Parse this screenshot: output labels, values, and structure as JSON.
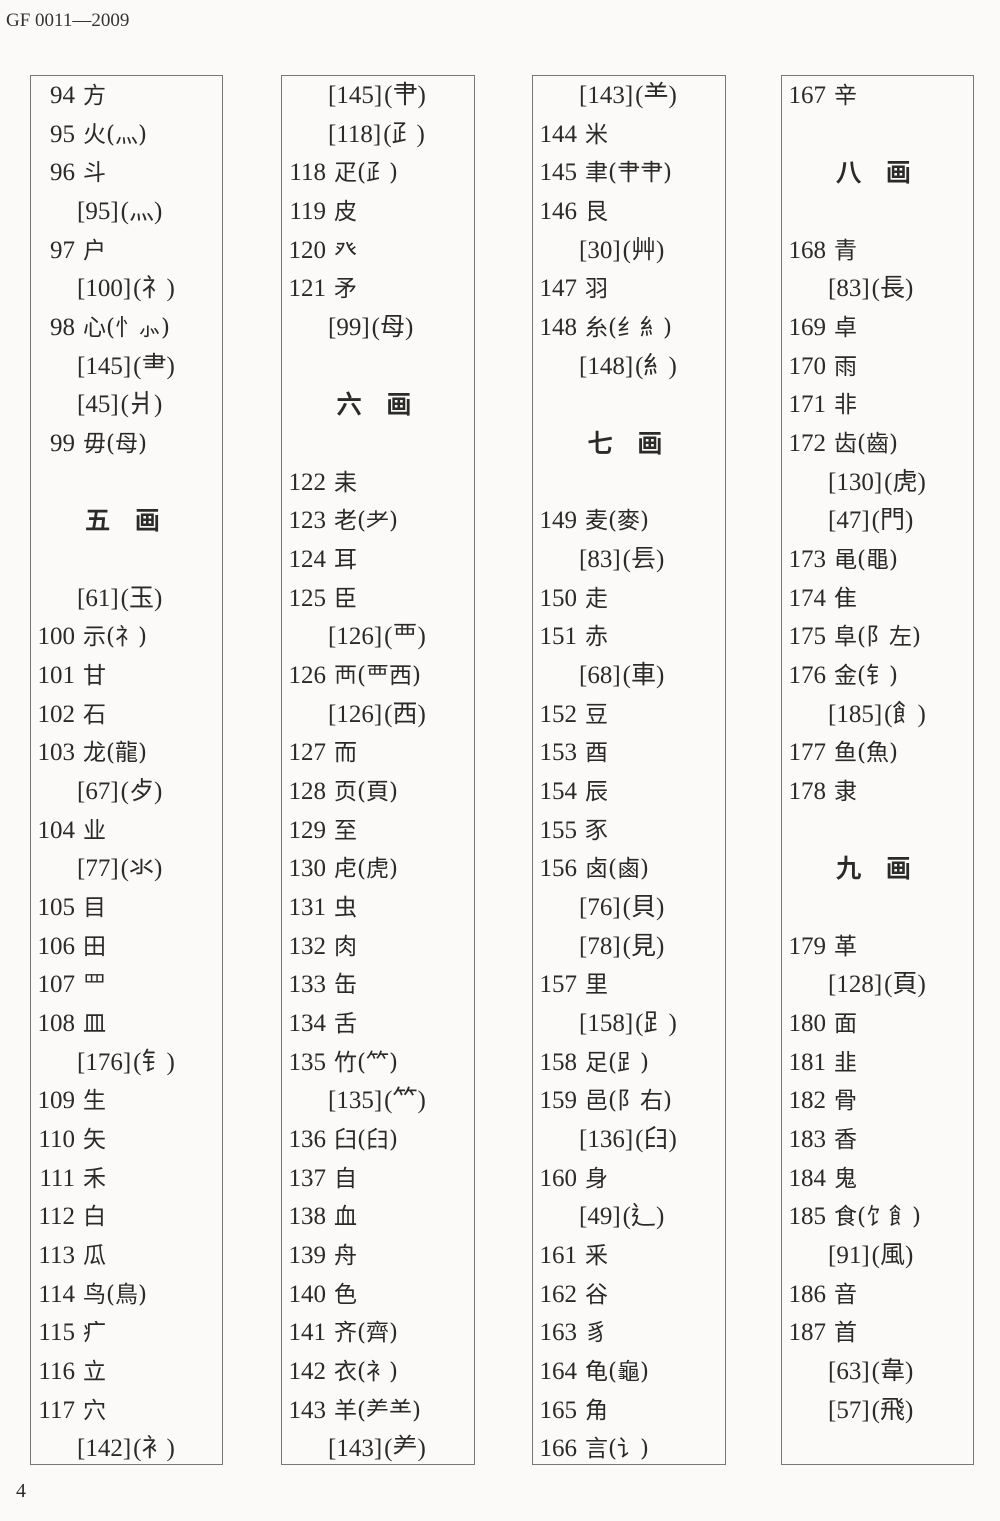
{
  "header": {
    "doc_id": "GF 0011—2009"
  },
  "footer": {
    "page_number": "4"
  },
  "columns": [
    [
      {
        "n": "94",
        "c": "方"
      },
      {
        "n": "95",
        "c": "火(灬)"
      },
      {
        "n": "96",
        "c": "斗"
      },
      {
        "ref": "[95]",
        "c": "(灬)"
      },
      {
        "n": "97",
        "c": "户"
      },
      {
        "ref": "[100]",
        "c": "(礻)"
      },
      {
        "n": "98",
        "c": "心(忄⺗)"
      },
      {
        "ref": "[145]",
        "c": "(⺻)"
      },
      {
        "ref": "[45]",
        "c": "(爿)"
      },
      {
        "n": "99",
        "c": "毋(母)"
      },
      null,
      {
        "h": "五 画"
      },
      null,
      {
        "ref": "[61]",
        "c": "(玉)"
      },
      {
        "n": "100",
        "c": "示(礻)"
      },
      {
        "n": "101",
        "c": "甘"
      },
      {
        "n": "102",
        "c": "石"
      },
      {
        "n": "103",
        "c": "龙(龍)"
      },
      {
        "ref": "[67]",
        "c": "(歺)"
      },
      {
        "n": "104",
        "c": "业"
      },
      {
        "ref": "[77]",
        "c": "(氺)"
      },
      {
        "n": "105",
        "c": "目"
      },
      {
        "n": "106",
        "c": "田"
      },
      {
        "n": "107",
        "c": "罒"
      },
      {
        "n": "108",
        "c": "皿"
      },
      {
        "ref": "[176]",
        "c": "(钅)"
      },
      {
        "n": "109",
        "c": "生"
      },
      {
        "n": "110",
        "c": "矢"
      },
      {
        "n": "111",
        "c": "禾"
      },
      {
        "n": "112",
        "c": "白"
      },
      {
        "n": "113",
        "c": "瓜"
      },
      {
        "n": "114",
        "c": "鸟(鳥)"
      },
      {
        "n": "115",
        "c": "疒"
      },
      {
        "n": "116",
        "c": "立"
      },
      {
        "n": "117",
        "c": "穴"
      },
      {
        "ref": "[142]",
        "c": "(衤)"
      }
    ],
    [
      {
        "ref": "[145]",
        "c": "(⺺)"
      },
      {
        "ref": "[118]",
        "c": "(⺪)"
      },
      {
        "n": "118",
        "c": "疋(⺪)"
      },
      {
        "n": "119",
        "c": "皮"
      },
      {
        "n": "120",
        "c": "癶"
      },
      {
        "n": "121",
        "c": "矛"
      },
      {
        "ref": "[99]",
        "c": "(母)"
      },
      null,
      {
        "h": "六 画"
      },
      null,
      {
        "n": "122",
        "c": "耒"
      },
      {
        "n": "123",
        "c": "老(耂)"
      },
      {
        "n": "124",
        "c": "耳"
      },
      {
        "n": "125",
        "c": "臣"
      },
      {
        "ref": "[126]",
        "c": "(覀)"
      },
      {
        "n": "126",
        "c": "襾(覀西)"
      },
      {
        "ref": "[126]",
        "c": "(西)"
      },
      {
        "n": "127",
        "c": "而"
      },
      {
        "n": "128",
        "c": "页(頁)"
      },
      {
        "n": "129",
        "c": "至"
      },
      {
        "n": "130",
        "c": "虍(虎)"
      },
      {
        "n": "131",
        "c": "虫"
      },
      {
        "n": "132",
        "c": "肉"
      },
      {
        "n": "133",
        "c": "缶"
      },
      {
        "n": "134",
        "c": "舌"
      },
      {
        "n": "135",
        "c": "竹(⺮)"
      },
      {
        "ref": "[135]",
        "c": "(⺮)"
      },
      {
        "n": "136",
        "c": "臼(𦥑)"
      },
      {
        "n": "137",
        "c": "自"
      },
      {
        "n": "138",
        "c": "血"
      },
      {
        "n": "139",
        "c": "舟"
      },
      {
        "n": "140",
        "c": "色"
      },
      {
        "n": "141",
        "c": "齐(齊)"
      },
      {
        "n": "142",
        "c": "衣(衤)"
      },
      {
        "n": "143",
        "c": "羊(⺶⺷)"
      },
      {
        "ref": "[143]",
        "c": "(⺶)"
      }
    ],
    [
      {
        "ref": "[143]",
        "c": "(⺷)"
      },
      {
        "n": "144",
        "c": "米"
      },
      {
        "n": "145",
        "c": "聿(肀⺺)"
      },
      {
        "n": "146",
        "c": "艮"
      },
      {
        "ref": "[30]",
        "c": "(艸)"
      },
      {
        "n": "147",
        "c": "羽"
      },
      {
        "n": "148",
        "c": "糸(纟糹)"
      },
      {
        "ref": "[148]",
        "c": "(糹)"
      },
      null,
      {
        "h": "七 画"
      },
      null,
      {
        "n": "149",
        "c": "麦(麥)"
      },
      {
        "ref": "[83]",
        "c": "(镸)"
      },
      {
        "n": "150",
        "c": "走"
      },
      {
        "n": "151",
        "c": "赤"
      },
      {
        "ref": "[68]",
        "c": "(車)"
      },
      {
        "n": "152",
        "c": "豆"
      },
      {
        "n": "153",
        "c": "酉"
      },
      {
        "n": "154",
        "c": "辰"
      },
      {
        "n": "155",
        "c": "豕"
      },
      {
        "n": "156",
        "c": "卤(鹵)"
      },
      {
        "ref": "[76]",
        "c": "(貝)"
      },
      {
        "ref": "[78]",
        "c": "(見)"
      },
      {
        "n": "157",
        "c": "里"
      },
      {
        "ref": "[158]",
        "c": "(⻊)"
      },
      {
        "n": "158",
        "c": "足(⻊)"
      },
      {
        "n": "159",
        "c": "邑(阝右)"
      },
      {
        "ref": "[136]",
        "c": "(𦥑)"
      },
      {
        "n": "160",
        "c": "身"
      },
      {
        "ref": "[49]",
        "c": "(⻎)"
      },
      {
        "n": "161",
        "c": "釆"
      },
      {
        "n": "162",
        "c": "谷"
      },
      {
        "n": "163",
        "c": "豸"
      },
      {
        "n": "164",
        "c": "龟(龜)"
      },
      {
        "n": "165",
        "c": "角"
      },
      {
        "n": "166",
        "c": "言(讠)"
      }
    ],
    [
      {
        "n": "167",
        "c": "辛"
      },
      null,
      {
        "h": "八 画"
      },
      null,
      {
        "n": "168",
        "c": "青"
      },
      {
        "ref": "[83]",
        "c": "(長)"
      },
      {
        "n": "169",
        "c": "卓"
      },
      {
        "n": "170",
        "c": "雨"
      },
      {
        "n": "171",
        "c": "非"
      },
      {
        "n": "172",
        "c": "齿(齒)"
      },
      {
        "ref": "[130]",
        "c": "(虎)"
      },
      {
        "ref": "[47]",
        "c": "(門)"
      },
      {
        "n": "173",
        "c": "黾(黽)"
      },
      {
        "n": "174",
        "c": "隹"
      },
      {
        "n": "175",
        "c": "阜(阝左)"
      },
      {
        "n": "176",
        "c": "金(钅)"
      },
      {
        "ref": "[185]",
        "c": "(飠)"
      },
      {
        "n": "177",
        "c": "鱼(魚)"
      },
      {
        "n": "178",
        "c": "隶"
      },
      null,
      {
        "h": "九 画"
      },
      null,
      {
        "n": "179",
        "c": "革"
      },
      {
        "ref": "[128]",
        "c": "(頁)"
      },
      {
        "n": "180",
        "c": "面"
      },
      {
        "n": "181",
        "c": "韭"
      },
      {
        "n": "182",
        "c": "骨"
      },
      {
        "n": "183",
        "c": "香"
      },
      {
        "n": "184",
        "c": "鬼"
      },
      {
        "n": "185",
        "c": "食(饣飠)"
      },
      {
        "ref": "[91]",
        "c": "(風)"
      },
      {
        "n": "186",
        "c": "音"
      },
      {
        "n": "187",
        "c": "首"
      },
      {
        "ref": "[63]",
        "c": "(韋)"
      },
      {
        "ref": "[57]",
        "c": "(飛)"
      }
    ]
  ]
}
